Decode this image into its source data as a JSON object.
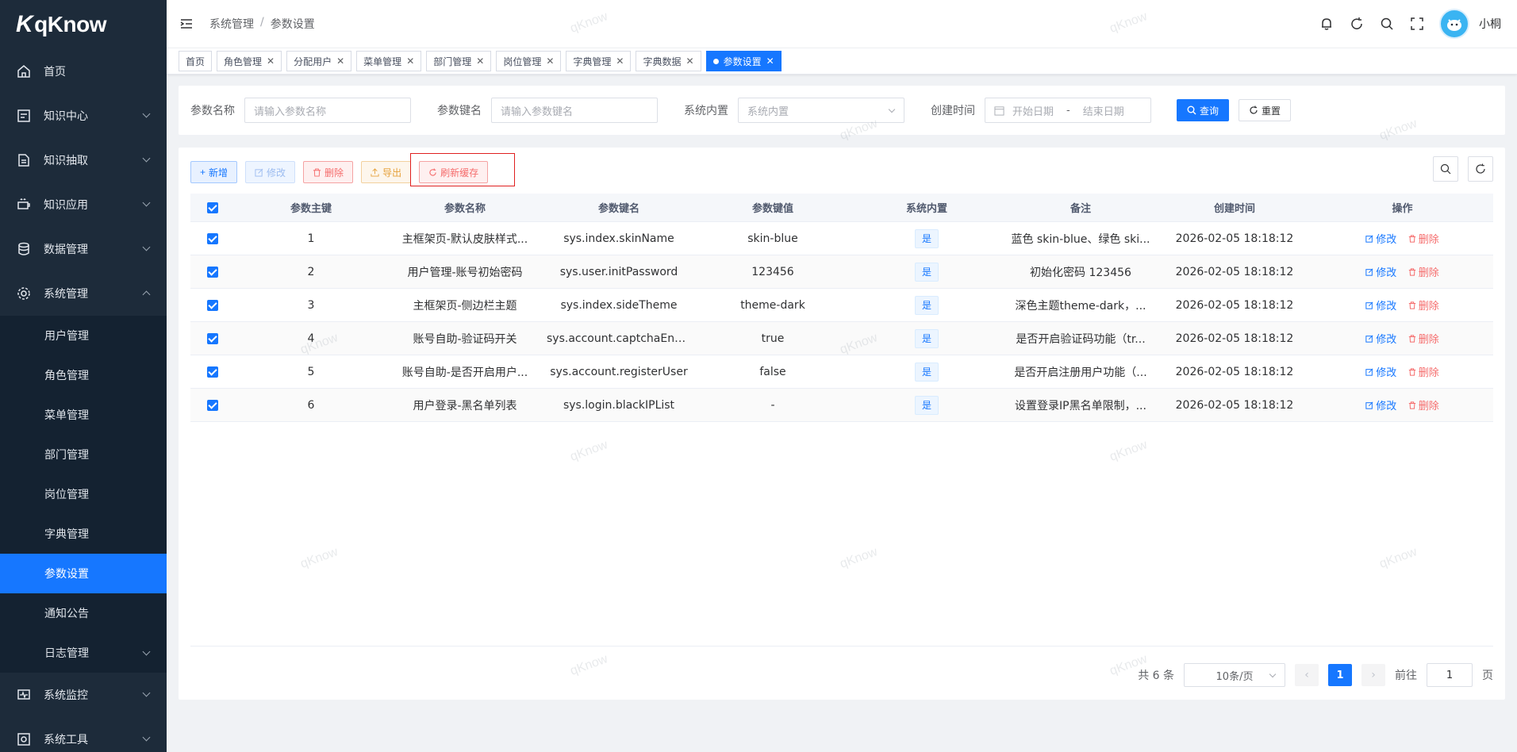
{
  "app": {
    "logo_text": "qKnow",
    "username": "小桐"
  },
  "sidebar": {
    "items": [
      {
        "label": "首页",
        "icon": "home-icon"
      },
      {
        "label": "知识中心",
        "icon": "knowledge-icon"
      },
      {
        "label": "知识抽取",
        "icon": "extract-icon"
      },
      {
        "label": "知识应用",
        "icon": "application-icon"
      },
      {
        "label": "数据管理",
        "icon": "database-icon"
      },
      {
        "label": "系统管理",
        "icon": "gear-icon"
      }
    ],
    "sub_items": [
      "用户管理",
      "角色管理",
      "菜单管理",
      "部门管理",
      "岗位管理",
      "字典管理",
      "参数设置",
      "通知公告",
      "日志管理"
    ],
    "bottom_items": [
      {
        "label": "系统监控",
        "icon": "monitor-icon"
      },
      {
        "label": "系统工具",
        "icon": "tools-icon"
      }
    ]
  },
  "breadcrumb": {
    "level1": "系统管理",
    "sep": "/",
    "level2": "参数设置"
  },
  "tags": [
    "首页",
    "角色管理",
    "分配用户",
    "菜单管理",
    "部门管理",
    "岗位管理",
    "字典管理",
    "字典数据",
    "参数设置"
  ],
  "tag_close": "✕",
  "search": {
    "name_label": "参数名称",
    "name_placeholder": "请输入参数名称",
    "key_label": "参数键名",
    "key_placeholder": "请输入参数键名",
    "builtin_label": "系统内置",
    "builtin_placeholder": "系统内置",
    "time_label": "创建时间",
    "start_placeholder": "开始日期",
    "range_sep": "-",
    "end_placeholder": "结束日期",
    "query_button": "查询",
    "reset_button": "重置"
  },
  "toolbar": {
    "add": "新增",
    "edit": "修改",
    "delete": "删除",
    "export": "导出",
    "refresh_cache": "刷新缓存"
  },
  "table": {
    "headers": [
      "参数主键",
      "参数名称",
      "参数键名",
      "参数键值",
      "系统内置",
      "备注",
      "创建时间",
      "操作"
    ],
    "rows": [
      {
        "id": "1",
        "name": "主框架页-默认皮肤样式...",
        "key": "sys.index.skinName",
        "value": "skin-blue",
        "builtin": "是",
        "remark": "蓝色 skin-blue、绿色 ski...",
        "time": "2026-02-05 18:18:12"
      },
      {
        "id": "2",
        "name": "用户管理-账号初始密码",
        "key": "sys.user.initPassword",
        "value": "123456",
        "builtin": "是",
        "remark": "初始化密码 123456",
        "time": "2026-02-05 18:18:12"
      },
      {
        "id": "3",
        "name": "主框架页-侧边栏主题",
        "key": "sys.index.sideTheme",
        "value": "theme-dark",
        "builtin": "是",
        "remark": "深色主题theme-dark，...",
        "time": "2026-02-05 18:18:12"
      },
      {
        "id": "4",
        "name": "账号自助-验证码开关",
        "key": "sys.account.captchaEna...",
        "value": "true",
        "builtin": "是",
        "remark": "是否开启验证码功能（tr...",
        "time": "2026-02-05 18:18:12"
      },
      {
        "id": "5",
        "name": "账号自助-是否开启用户...",
        "key": "sys.account.registerUser",
        "value": "false",
        "builtin": "是",
        "remark": "是否开启注册用户功能（...",
        "time": "2026-02-05 18:18:12"
      },
      {
        "id": "6",
        "name": "用户登录-黑名单列表",
        "key": "sys.login.blackIPList",
        "value": "-",
        "builtin": "是",
        "remark": "设置登录IP黑名单限制，...",
        "time": "2026-02-05 18:18:12"
      }
    ],
    "op_edit": "修改",
    "op_delete": "删除"
  },
  "pagination": {
    "total": "共 6 条",
    "page_size": "10条/页",
    "current": "1",
    "goto_label": "前往",
    "goto_value": "1",
    "goto_suffix": "页",
    "prev": "‹",
    "next": "›"
  },
  "watermark": "qKnow",
  "colors": {
    "primary": "#1677ff",
    "sidebar_bg": "#1d2b3a",
    "danger": "#f56c6c",
    "warning": "#e6a23c"
  }
}
